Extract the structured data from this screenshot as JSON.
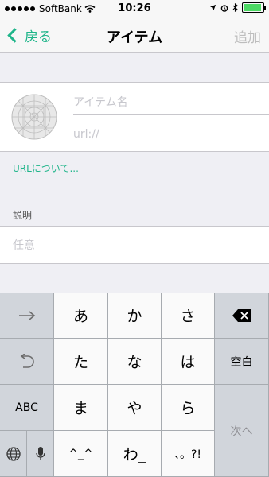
{
  "status_bar": {
    "carrier": "SoftBank",
    "time": "10:26"
  },
  "nav": {
    "back_label": "戻る",
    "title": "アイテム",
    "add_label": "追加"
  },
  "form": {
    "name_placeholder": "アイテム名",
    "url_placeholder": "url://",
    "url_about_link": "URLについて...",
    "description_header": "説明",
    "description_placeholder": "任意"
  },
  "keyboard": {
    "row1": [
      "あ",
      "か",
      "さ"
    ],
    "row2": [
      "た",
      "な",
      "は"
    ],
    "row3": [
      "ま",
      "や",
      "ら"
    ],
    "row4": [
      "^_^",
      "わ_",
      "、。?!"
    ],
    "abc_label": "ABC",
    "space_label": "空白",
    "next_label": "次へ"
  }
}
